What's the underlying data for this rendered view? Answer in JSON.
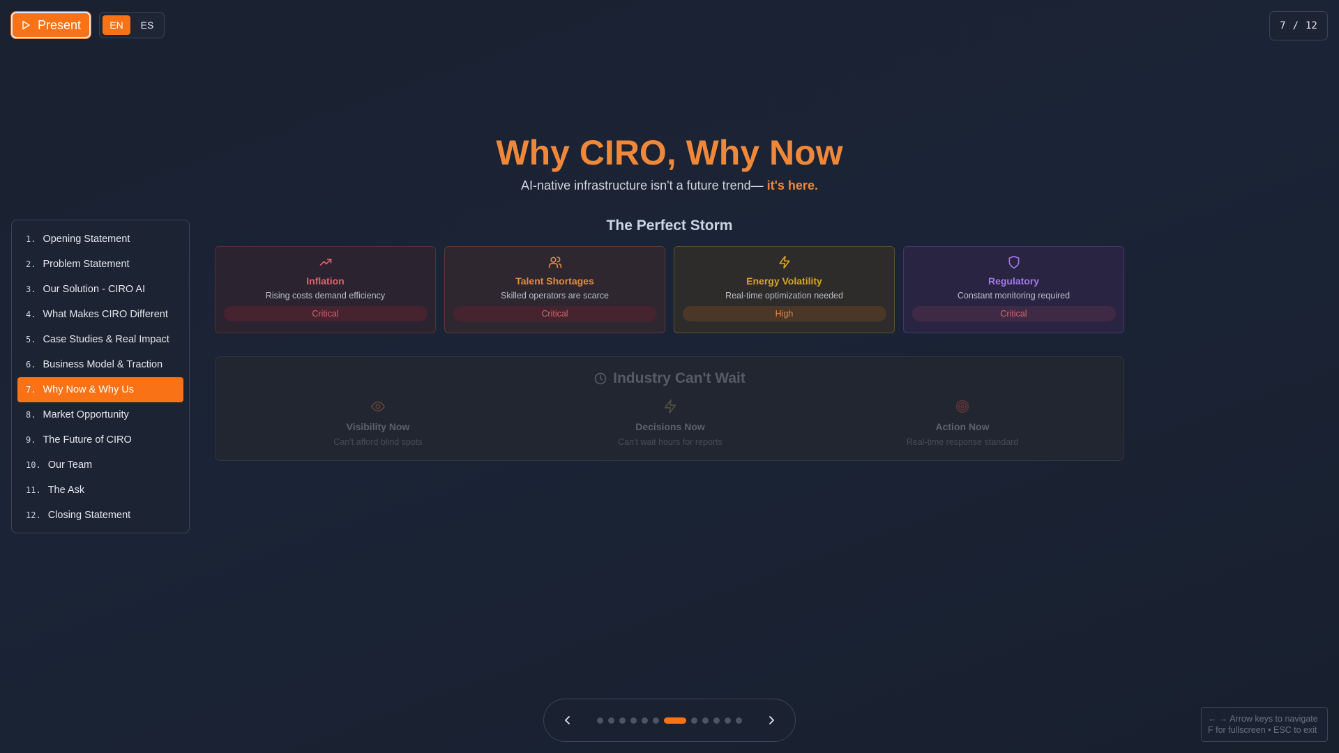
{
  "toolbar": {
    "present_label": "Present",
    "languages": [
      {
        "label": "EN",
        "active": true
      },
      {
        "label": "ES",
        "active": false
      }
    ]
  },
  "counter": {
    "current": "7",
    "separator": "/",
    "total": "12"
  },
  "sidebar": {
    "items": [
      {
        "num": "1.",
        "label": "Opening Statement"
      },
      {
        "num": "2.",
        "label": "Problem Statement"
      },
      {
        "num": "3.",
        "label": "Our Solution - CIRO AI"
      },
      {
        "num": "4.",
        "label": "What Makes CIRO Different"
      },
      {
        "num": "5.",
        "label": "Case Studies & Real Impact"
      },
      {
        "num": "6.",
        "label": "Business Model & Traction"
      },
      {
        "num": "7.",
        "label": "Why Now & Why Us"
      },
      {
        "num": "8.",
        "label": "Market Opportunity"
      },
      {
        "num": "9.",
        "label": "The Future of CIRO"
      },
      {
        "num": "10.",
        "label": "Our Team"
      },
      {
        "num": "11.",
        "label": "The Ask"
      },
      {
        "num": "12.",
        "label": "Closing Statement"
      }
    ],
    "active_index": 6
  },
  "slide": {
    "title": "Why CIRO, Why Now",
    "subtitle_prefix": "AI-native infrastructure isn't a future trend—",
    "subtitle_highlight": " it's here.",
    "storm_heading": "The Perfect Storm",
    "cards": [
      {
        "icon": "trending-up-icon",
        "title": "Inflation",
        "desc": "Rising costs demand efficiency",
        "badge": "Critical",
        "color": "#e0636a"
      },
      {
        "icon": "users-icon",
        "title": "Talent Shortages",
        "desc": "Skilled operators are scarce",
        "badge": "Critical",
        "color": "#e38a3f"
      },
      {
        "icon": "lightning-icon",
        "title": "Energy Volatility",
        "desc": "Real-time optimization needed",
        "badge": "High",
        "color": "#d9a525"
      },
      {
        "icon": "shield-icon",
        "title": "Regulatory",
        "desc": "Constant monitoring required",
        "badge": "Critical",
        "color": "#a277e6"
      }
    ],
    "wait_heading": "Industry Can't Wait",
    "wait_items": [
      {
        "icon": "eye-icon",
        "title": "Visibility Now",
        "desc": "Can't afford blind spots"
      },
      {
        "icon": "lightning-icon",
        "title": "Decisions Now",
        "desc": "Can't wait hours for reports"
      },
      {
        "icon": "target-icon",
        "title": "Action Now",
        "desc": "Real-time response standard"
      }
    ]
  },
  "pager": {
    "total": 12,
    "active_index": 6
  },
  "hint": {
    "line1": "← → Arrow keys to navigate",
    "line2": "F for fullscreen • ESC to exit"
  },
  "colors": {
    "accent": "#f97316",
    "title": "#f0883a"
  }
}
